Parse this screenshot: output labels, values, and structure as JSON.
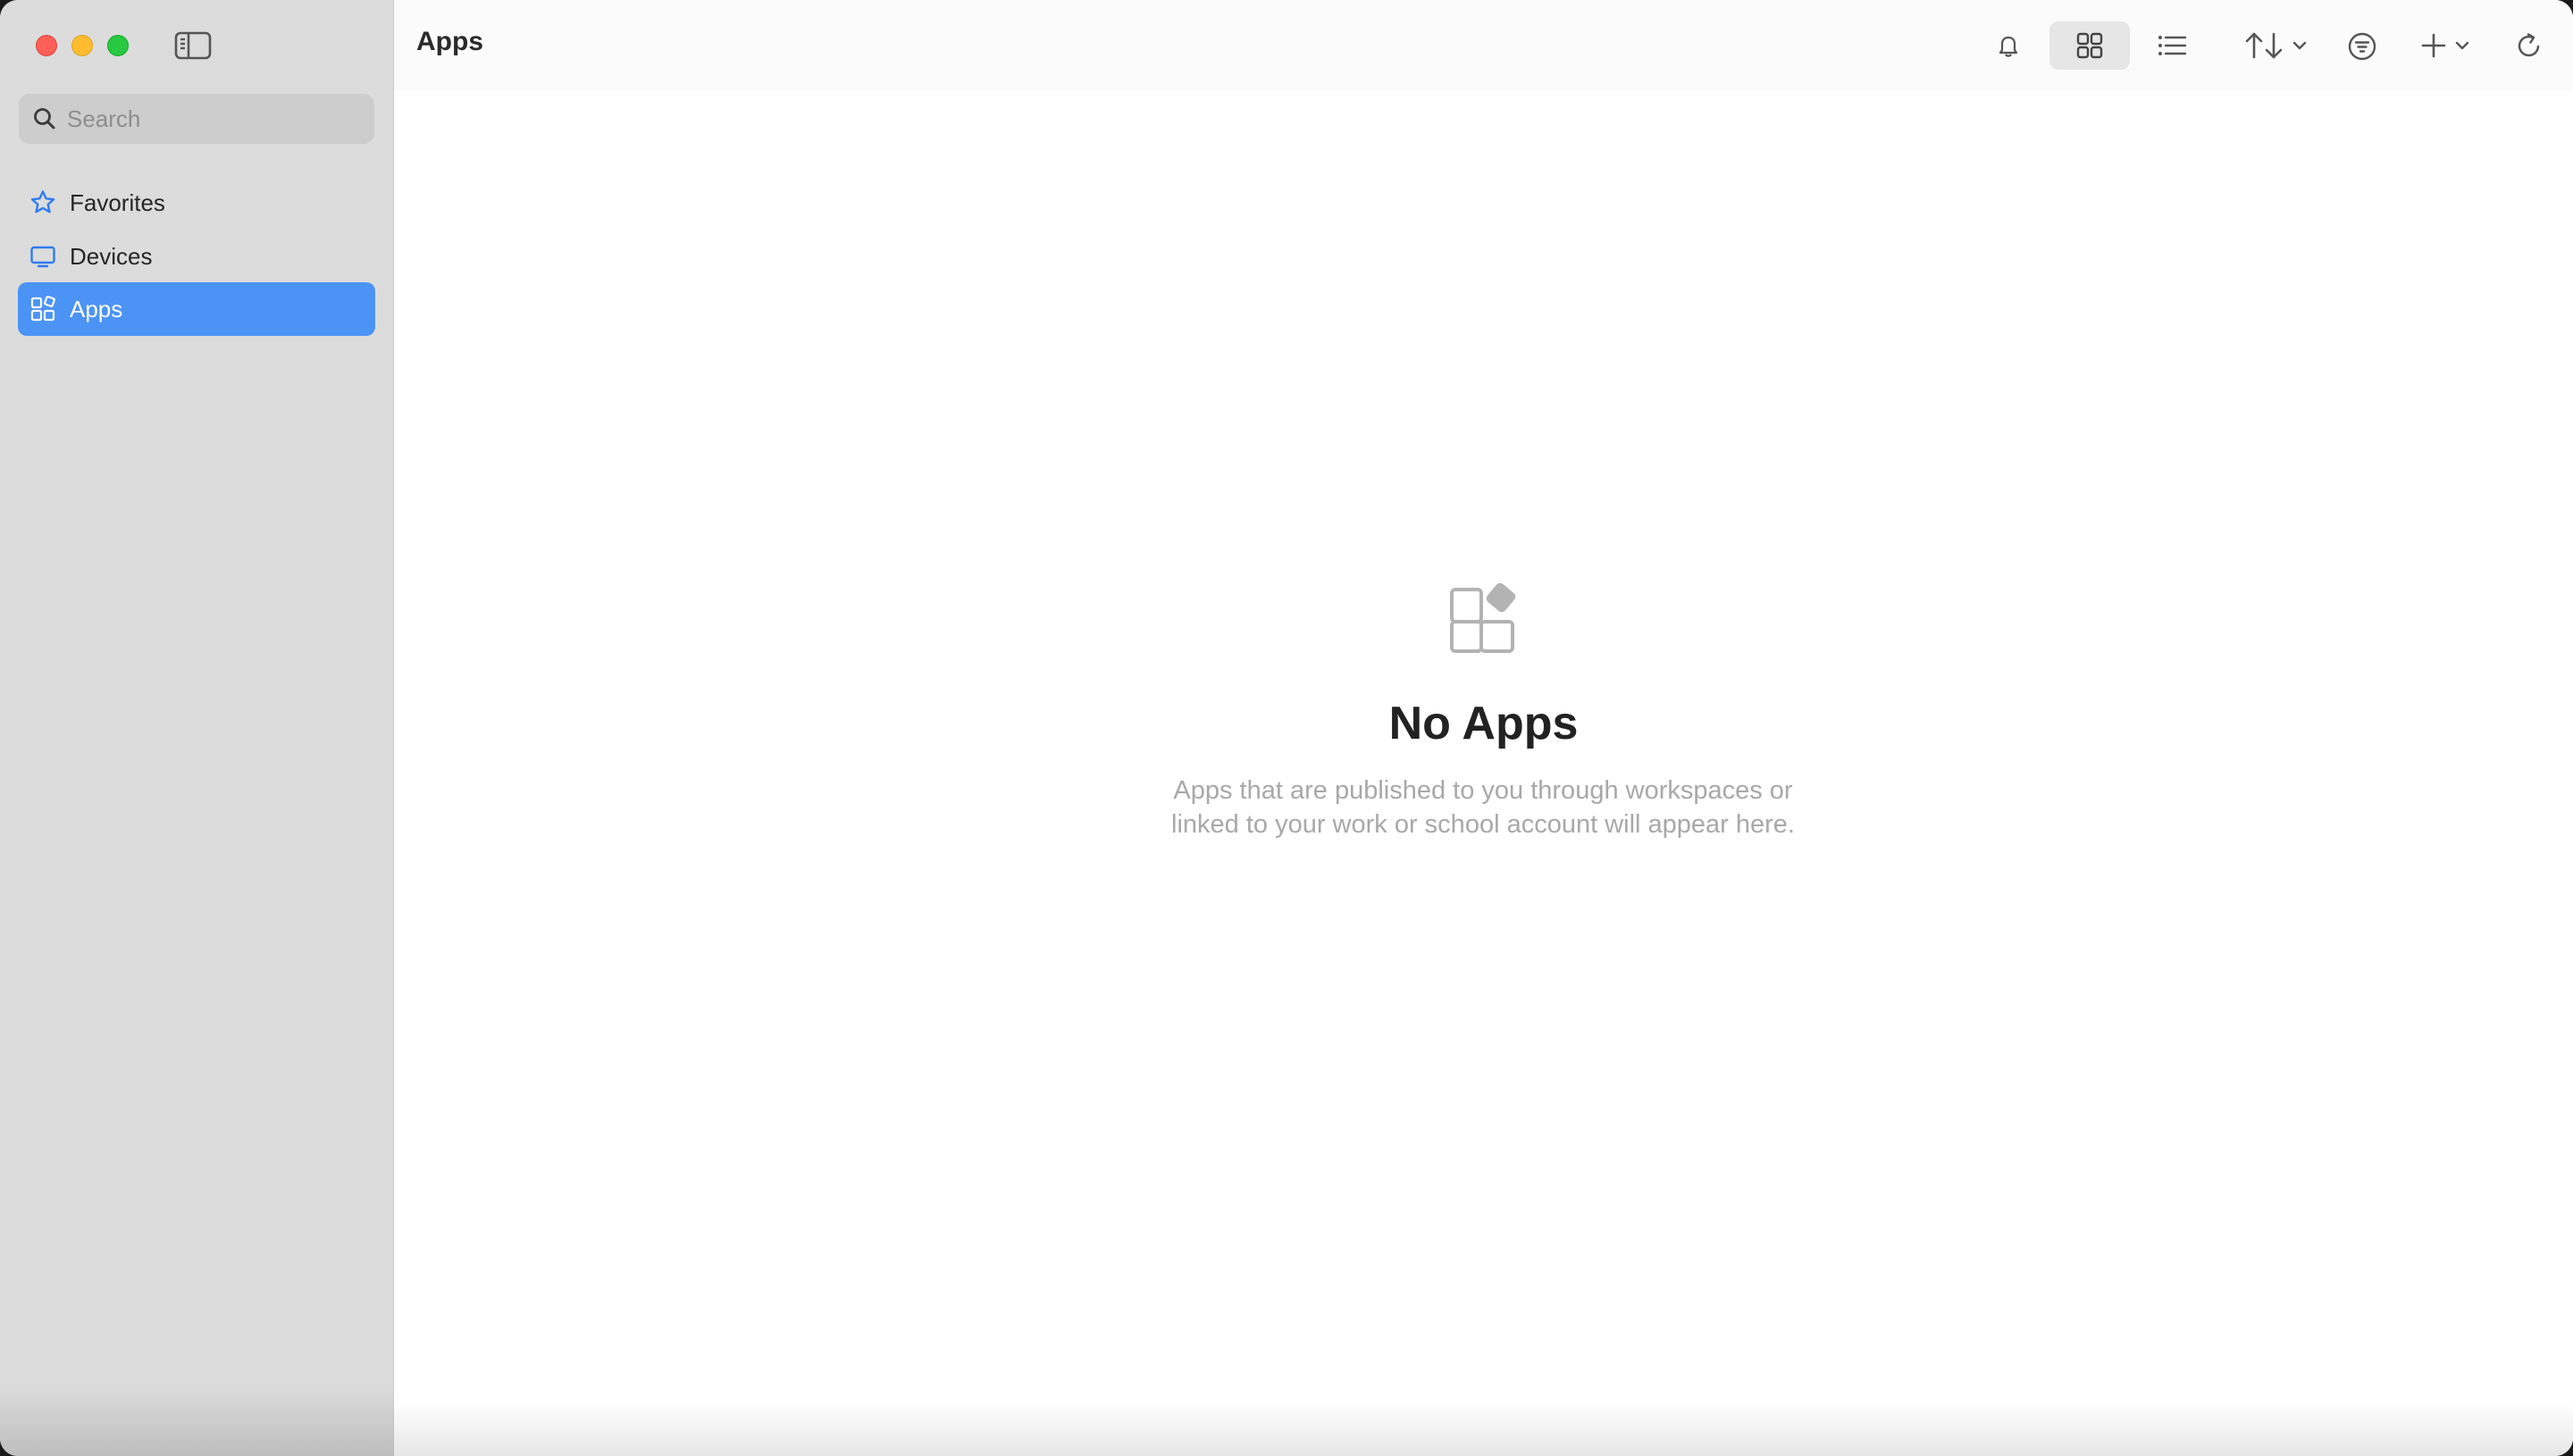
{
  "window": {
    "title": "Apps",
    "controls": [
      "close",
      "minimize",
      "zoom"
    ]
  },
  "sidebar": {
    "toggle_icon": "sidebar-toggle-icon",
    "search": {
      "placeholder": "Search",
      "value": "",
      "icon": "search-icon"
    },
    "items": [
      {
        "label": "Favorites",
        "icon": "star-icon",
        "active": false
      },
      {
        "label": "Devices",
        "icon": "monitor-icon",
        "active": false
      },
      {
        "label": "Apps",
        "icon": "apps-grid-icon",
        "active": true
      }
    ]
  },
  "toolbar": {
    "title": "Apps",
    "buttons": [
      {
        "name": "notifications",
        "icon": "bell-icon"
      },
      {
        "name": "grid-view",
        "icon": "grid-view-icon",
        "selected": true
      },
      {
        "name": "list-view",
        "icon": "list-view-icon"
      },
      {
        "name": "sort",
        "icon": "sort-arrows-icon",
        "dropdown": true
      },
      {
        "name": "filter",
        "icon": "filter-icon"
      },
      {
        "name": "add",
        "icon": "plus-icon",
        "dropdown": true
      },
      {
        "name": "refresh",
        "icon": "refresh-icon"
      }
    ]
  },
  "empty_state": {
    "icon": "empty-apps-icon",
    "title": "No Apps",
    "description_line1": "Apps that are published to you through workspaces or",
    "description_line2": "linked to your work or school account will appear here."
  },
  "colors": {
    "accent": "#4b93f5",
    "sidebar_bg": "#dcdcdc",
    "close": "#fe5f57",
    "minimize": "#febc2e",
    "zoom": "#28c840"
  }
}
